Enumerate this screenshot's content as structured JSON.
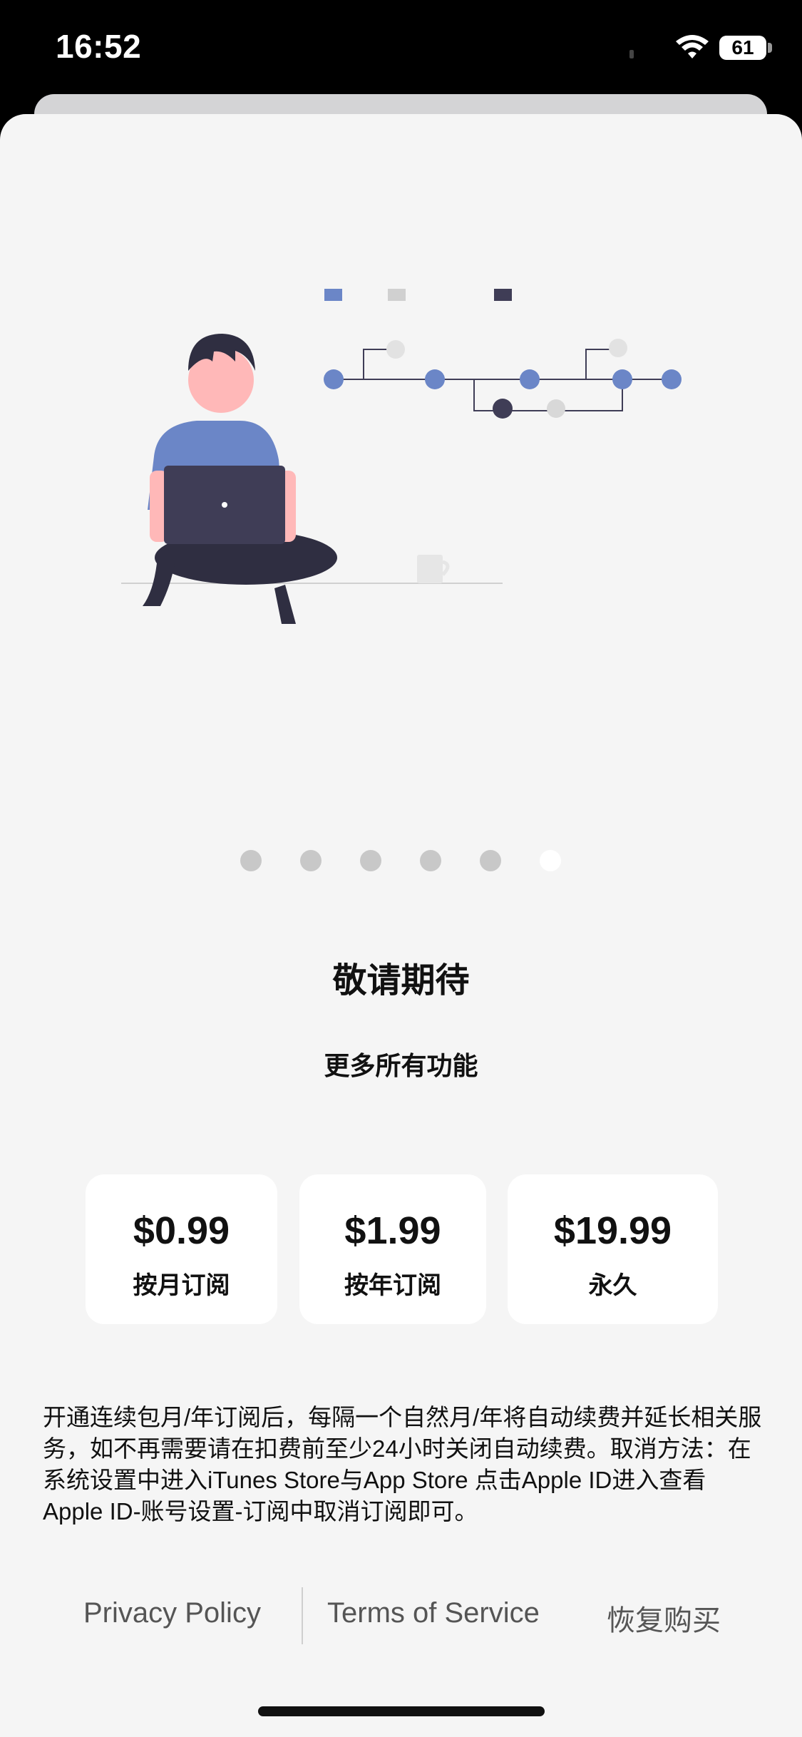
{
  "status_bar": {
    "time": "16:52",
    "battery": "61",
    "icons": [
      "wifi-icon",
      "battery-icon"
    ]
  },
  "illustration": {
    "name": "person-with-laptop-timeline-illustration",
    "colors": {
      "accent": "#6b86c7",
      "dark": "#3f3d56",
      "skin": "#ffb8b8",
      "light": "#d0d0d0"
    }
  },
  "pager": {
    "count": 6,
    "active_index": 5
  },
  "header": {
    "title": "敬请期待",
    "subtitle": "更多所有功能"
  },
  "plans": [
    {
      "price": "$0.99",
      "label": "按月订阅"
    },
    {
      "price": "$1.99",
      "label": "按年订阅"
    },
    {
      "price": "$19.99",
      "label": "永久"
    }
  ],
  "notice": "开通连续包月/年订阅后，每隔一个自然月/年将自动续费并延长相关服务，如不再需要请在扣费前至少24小时关闭自动续费。取消方法：在系统设置中进入iTunes Store与App Store 点击Apple ID进入查看Apple ID-账号设置-订阅中取消订阅即可。",
  "footer": {
    "privacy": "Privacy Policy",
    "terms": "Terms of Service",
    "restore": "恢复购买"
  }
}
